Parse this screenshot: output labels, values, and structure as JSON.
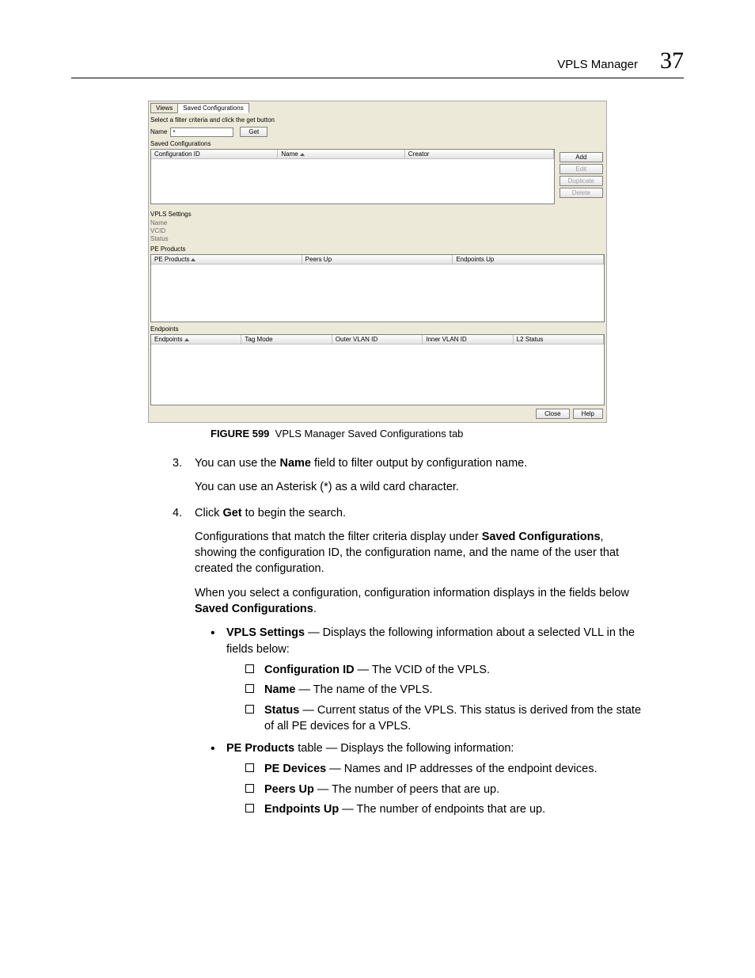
{
  "header": {
    "title": "VPLS Manager",
    "chapter": "37"
  },
  "screenshot": {
    "tabs": {
      "views": "Views",
      "saved": "Saved Configurations"
    },
    "filter_instr": "Select a filter criteria and click the get button",
    "name_label": "Name",
    "name_value": "*",
    "get_btn": "Get",
    "saved_title": "Saved Configurations",
    "saved_cols": {
      "cfgid": "Configuration ID",
      "name": "Name",
      "creator": "Creator"
    },
    "buttons": {
      "add": "Add",
      "edit": "Edit",
      "duplicate": "Duplicate",
      "delete": "Delete"
    },
    "vpls_title": "VPLS Settings",
    "vpls_fields": {
      "name": "Name",
      "vcid": "VCID",
      "status": "Status"
    },
    "pe_title": "PE Products",
    "pe_cols": {
      "prod": "PE Products",
      "peers": "Peers Up",
      "endpoints": "Endpoints Up"
    },
    "ep_title": "Endpoints",
    "ep_cols": {
      "ep": "Endpoints",
      "tag": "Tag Mode",
      "outer": "Outer VLAN ID",
      "inner": "Inner VLAN ID",
      "l2": "L2 Status"
    },
    "footer": {
      "close": "Close",
      "help": "Help"
    }
  },
  "caption": {
    "label": "FIGURE 599",
    "text": "VPLS Manager Saved Configurations tab"
  },
  "steps": {
    "s3a": "You can use the ",
    "s3b": "Name",
    "s3c": " field to filter output by configuration name.",
    "s3sub": "You can use an Asterisk (*) as a wild card character.",
    "s4a": "Click ",
    "s4b": "Get",
    "s4c": " to begin the search.",
    "s4p1a": "Configurations that match the filter criteria display under ",
    "s4p1b": "Saved Configurations",
    "s4p1c": ", showing the configuration ID, the configuration name, and the name of the user that created the configuration.",
    "s4p2a": "When you select a configuration, configuration information displays in the fields below ",
    "s4p2b": "Saved Configurations",
    "s4p2c": "."
  },
  "bullets": {
    "b1a": "VPLS Settings",
    "b1b": " — Displays the following information about a selected VLL in the fields below:",
    "b1_1a": "Configuration ID",
    "b1_1b": " — The VCID of the VPLS.",
    "b1_2a": "Name",
    "b1_2b": " — The name of the VPLS.",
    "b1_3a": "Status",
    "b1_3b": " — Current status of the VPLS. This status is derived from the state of all PE devices for a VPLS.",
    "b2a": "PE Products",
    "b2b": " table — Displays the following information:",
    "b2_1a": "PE Devices",
    "b2_1b": " — Names and IP addresses of the endpoint devices.",
    "b2_2a": "Peers Up",
    "b2_2b": " — The number of peers that are up.",
    "b2_3a": "Endpoints Up",
    "b2_3b": " — The number of endpoints that are up."
  }
}
